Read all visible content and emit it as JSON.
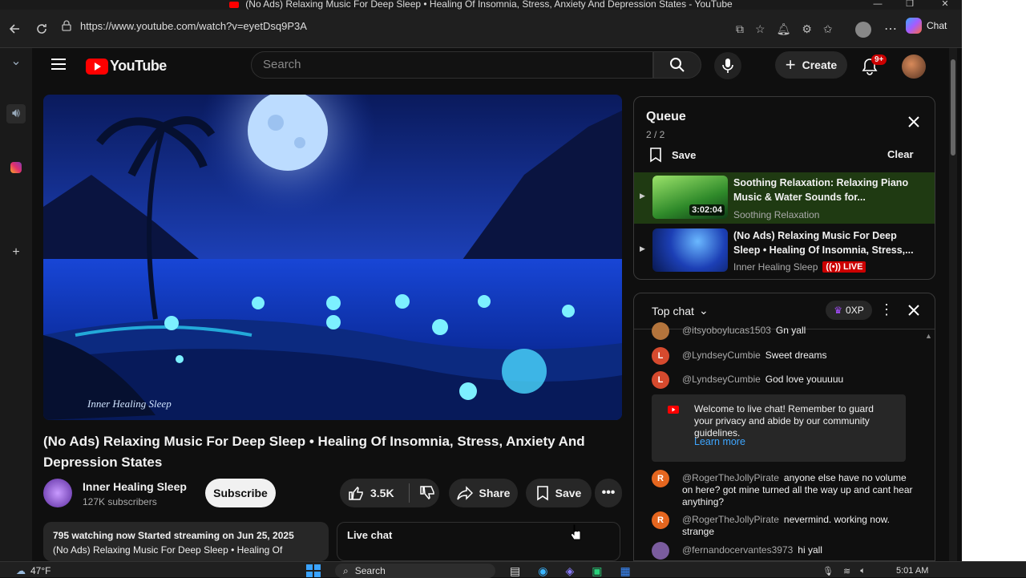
{
  "browser": {
    "window_title": "(No Ads) Relaxing Music For Deep Sleep • Healing Of Insomnia, Stress, Anxiety And Depression States - YouTube",
    "url": "https://www.youtube.com/watch?v=eyetDsq9P3A",
    "chat_label": "Chat"
  },
  "header": {
    "logo_text": "YouTube",
    "search_placeholder": "Search",
    "create_label": "Create",
    "notifications_badge": "9+"
  },
  "video": {
    "watermark": "Inner Healing Sleep",
    "title": "(No Ads) Relaxing Music For Deep Sleep • Healing Of Insomnia, Stress, Anxiety And Depression States",
    "channel": "Inner Healing Sleep",
    "subscribers": "127K subscribers",
    "subscribe_label": "Subscribe",
    "likes": "3.5K",
    "share_label": "Share",
    "save_label": "Save",
    "description_stats": "795 watching now  Started streaming on Jun 25, 2025",
    "description_text": "(No Ads) Relaxing Music For Deep Sleep • Healing Of",
    "live_chat_label": "Live chat"
  },
  "queue": {
    "title": "Queue",
    "position": "2 / 2",
    "save_label": "Save",
    "clear_label": "Clear",
    "items": [
      {
        "title": "Soothing Relaxation: Relaxing Piano Music & Water Sounds for...",
        "channel": "Soothing Relaxation",
        "duration": "3:02:04"
      },
      {
        "title": "(No Ads) Relaxing Music For Deep Sleep • Healing Of Insomnia, Stress,...",
        "channel": "Inner Healing Sleep",
        "badge": "LIVE"
      }
    ]
  },
  "chat": {
    "mode_label": "Top chat",
    "xp_label": "0XP",
    "messages": [
      {
        "user": "@itsyoboylucas1503",
        "text": "Gn yall",
        "initial": "",
        "color": "#b3743c"
      },
      {
        "user": "@LyndseyCumbie",
        "text": "Sweet dreams",
        "initial": "L",
        "color": "#d64a2e"
      },
      {
        "user": "@LyndseyCumbie",
        "text": "God love youuuuu",
        "initial": "L",
        "color": "#d64a2e"
      },
      {
        "user": "@RogerTheJollyPirate",
        "text": "anyone else have no volume on here? got mine turned all the way up and cant hear anything?",
        "initial": "R",
        "color": "#e5661f"
      },
      {
        "user": "@RogerTheJollyPirate",
        "text": "nevermind. working now. strange",
        "initial": "R",
        "color": "#e5661f"
      },
      {
        "user": "@fernandocervantes3973",
        "text": "hi yall",
        "initial": "",
        "color": "#7a5c9e"
      }
    ],
    "welcome_text": "Welcome to live chat! Remember to guard your privacy and abide by our community guidelines.",
    "learn_more": "Learn more"
  },
  "taskbar": {
    "temperature": "47°F",
    "search_label": "Search",
    "time": "5:01 AM"
  },
  "colors": {
    "youtube_red": "#ff0000",
    "queue_active": "#1f3a12",
    "link_blue": "#3ea6ff"
  }
}
